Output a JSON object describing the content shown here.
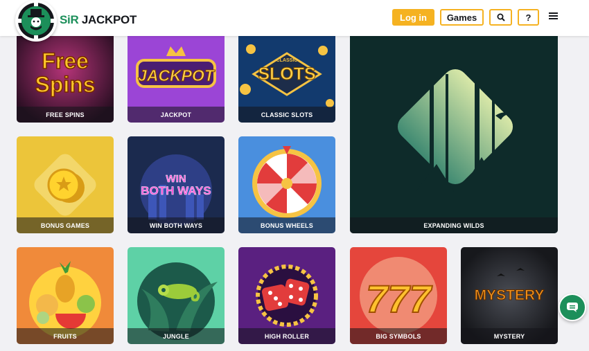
{
  "header": {
    "logo_prefix": "SiR",
    "logo_name": "JACKPOT",
    "login_label": "Log in",
    "games_label": "Games",
    "help_label": "?"
  },
  "tiles": [
    {
      "caption": "FREE SPINS",
      "art_text_1": "Free",
      "art_text_2": "Spins"
    },
    {
      "caption": "JACKPOT",
      "art_text": "JACKPOT"
    },
    {
      "caption": "CLASSIC SLOTS",
      "art_text_small": "CLASSIC",
      "art_text": "SLOTS"
    },
    {
      "caption": "EXPANDING WILDS"
    },
    {
      "caption": "BONUS GAMES"
    },
    {
      "caption": "WIN BOTH WAYS",
      "art_text_1": "WIN",
      "art_text_2": "BOTH WAYS"
    },
    {
      "caption": "BONUS WHEELS"
    },
    {
      "caption": "FRUITS"
    },
    {
      "caption": "JUNGLE"
    },
    {
      "caption": "HIGH ROLLER"
    },
    {
      "caption": "BIG SYMBOLS",
      "art_text": "777"
    },
    {
      "caption": "MYSTERY",
      "art_text": "MYSTERY"
    }
  ],
  "colors": {
    "brand_green": "#1c8f5a",
    "accent_yellow": "#f5b221"
  }
}
